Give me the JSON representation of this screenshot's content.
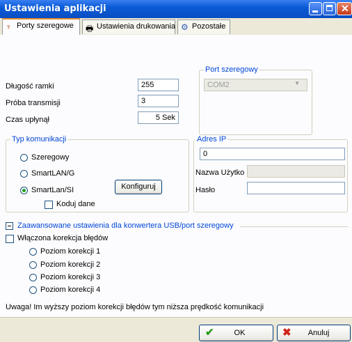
{
  "window": {
    "title": "Ustawienia aplikacji"
  },
  "tabs": [
    {
      "label": "Porty szeregowe",
      "icon": "serial-port-icon",
      "active": true
    },
    {
      "label": "Ustawienia drukowania",
      "icon": "printer-icon",
      "active": false
    },
    {
      "label": "Pozostałe",
      "icon": "settings-icon",
      "active": false
    }
  ],
  "fields": {
    "frame_length": {
      "label": "Długość ramki",
      "value": "255"
    },
    "transmission_attempt": {
      "label": "Próba transmisji",
      "value": "3"
    },
    "timeout": {
      "label": "Czas upłynął",
      "value": "5 Sek"
    }
  },
  "serial_port": {
    "legend": "Port szeregowy",
    "value": "COM2"
  },
  "comm_type": {
    "legend": "Typ komunikacji",
    "options": [
      "Szeregowy",
      "SmartLAN/G",
      "SmartLan/SI"
    ],
    "selected": "SmartLan/SI",
    "configure_label": "Konfiguruj",
    "encode_label": "Koduj dane"
  },
  "ip": {
    "legend": "Adres IP",
    "value": "0",
    "username_label": "Nazwa Użytko",
    "username_value": "",
    "password_label": "Hasło",
    "password_value": ""
  },
  "advanced": {
    "header": "Zaawansowane ustawienia dla konwertera USB/port szeregowy",
    "error_correction_label": "Włączona korekcja błędów",
    "levels": [
      "Poziom korekcji 1",
      "Poziom korekcji 2",
      "Poziom korekcji 3",
      "Poziom korekcji 4"
    ],
    "warning": "Uwaga! Im wyższy poziom korekcji błędów tym niższa prędkość komunikacji"
  },
  "buttons": {
    "ok": "OK",
    "cancel": "Anuluj"
  },
  "colors": {
    "accent": "#0046d5",
    "titlebar": "#0b5ad6"
  }
}
